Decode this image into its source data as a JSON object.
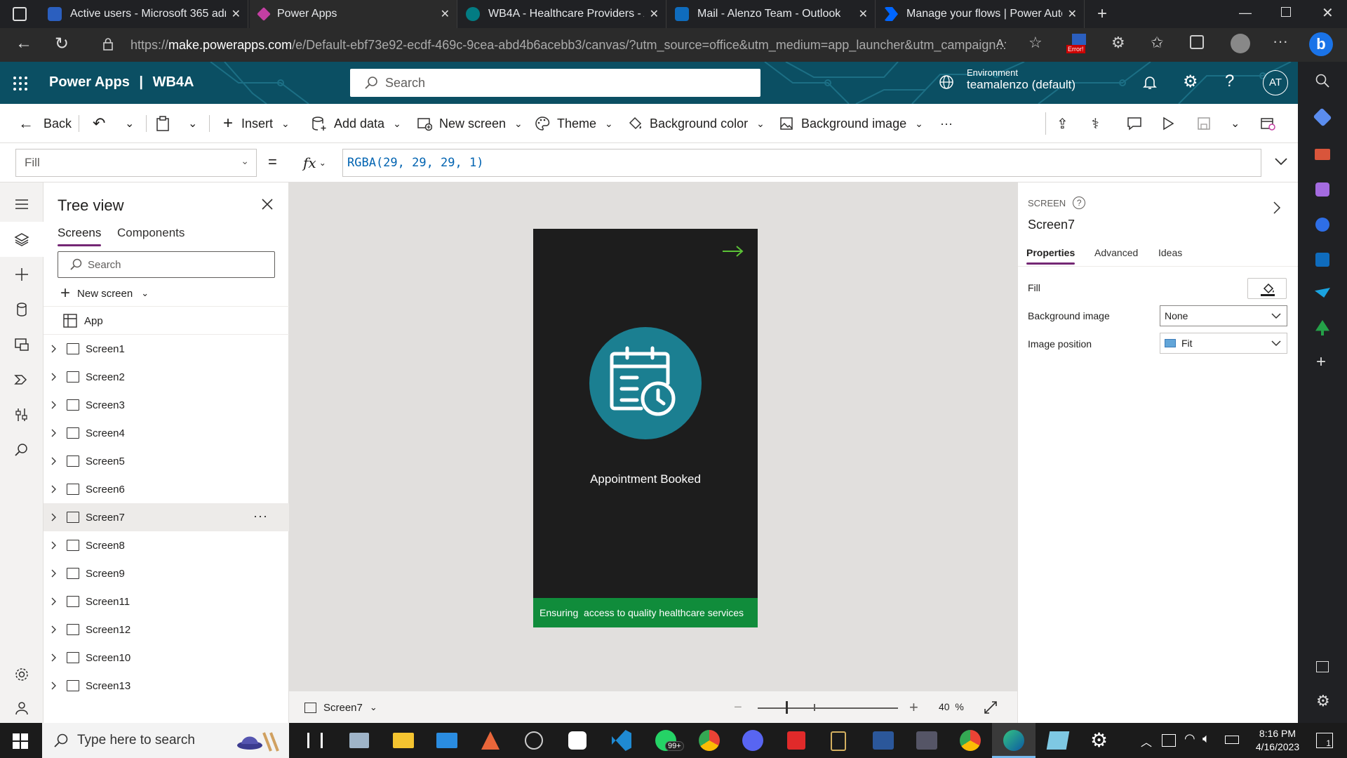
{
  "browser": {
    "tabs": [
      {
        "title": "Active users - Microsoft 365 adm",
        "color": "#2b5fbf"
      },
      {
        "title": "Power Apps",
        "color": "#c43fa3"
      },
      {
        "title": "WB4A - Healthcare Providers - A",
        "color": "#037c83"
      },
      {
        "title": "Mail - Alenzo Team - Outlook",
        "color": "#0f6cbd"
      },
      {
        "title": "Manage your flows | Power Auto",
        "color": "#0066ff"
      }
    ],
    "url_prefix": "https://",
    "url_host": "make.powerapps.com",
    "url_rest": "/e/Default-ebf73e92-ecdf-469c-9cea-abd4b6acebb3/canvas/?utm_source=office&utm_medium=app_launcher&utm_campaign...",
    "error_badge": "Error!"
  },
  "header": {
    "app_name": "Power Apps",
    "separator": "|",
    "project": "WB4A",
    "search_placeholder": "Search",
    "env_label": "Environment",
    "env_name": "teamalenzo (default)",
    "avatar": "AT"
  },
  "commands": {
    "back": "Back",
    "insert": "Insert",
    "add_data": "Add data",
    "new_screen": "New screen",
    "theme": "Theme",
    "bg_color": "Background color",
    "bg_image": "Background image",
    "more": "···"
  },
  "formula_bar": {
    "property": "Fill",
    "equals": "=",
    "fx": "fx",
    "formula": "RGBA(29, 29, 29, 1)"
  },
  "tree": {
    "title": "Tree view",
    "tabs": [
      "Screens",
      "Components"
    ],
    "search_placeholder": "Search",
    "new_screen": "New screen",
    "app": "App",
    "screens": [
      "Screen1",
      "Screen2",
      "Screen3",
      "Screen4",
      "Screen5",
      "Screen6",
      "Screen7",
      "Screen8",
      "Screen9",
      "Screen11",
      "Screen12",
      "Screen10",
      "Screen13"
    ],
    "selected": "Screen7",
    "more": "···"
  },
  "phone": {
    "title": "Appointment Booked",
    "footer": "Ensuring  access to quality healthcare services",
    "bg": "#1d1d1d",
    "circle_color": "#1b7f91",
    "footer_color": "#108c3b",
    "arrow_color": "#5bc236"
  },
  "canvas_footer": {
    "screen": "Screen7",
    "zoom": "40",
    "zoom_unit": "%"
  },
  "properties": {
    "kind": "SCREEN",
    "name": "Screen7",
    "tabs": [
      "Properties",
      "Advanced",
      "Ideas"
    ],
    "fill_label": "Fill",
    "bg_image_label": "Background image",
    "bg_image_value": "None",
    "img_pos_label": "Image position",
    "img_pos_value": "Fit"
  },
  "taskbar": {
    "search_placeholder": "Type here to search",
    "time": "8:16 PM",
    "date": "4/16/2023",
    "whatsapp_badge": "99+",
    "notif_count": "1"
  }
}
